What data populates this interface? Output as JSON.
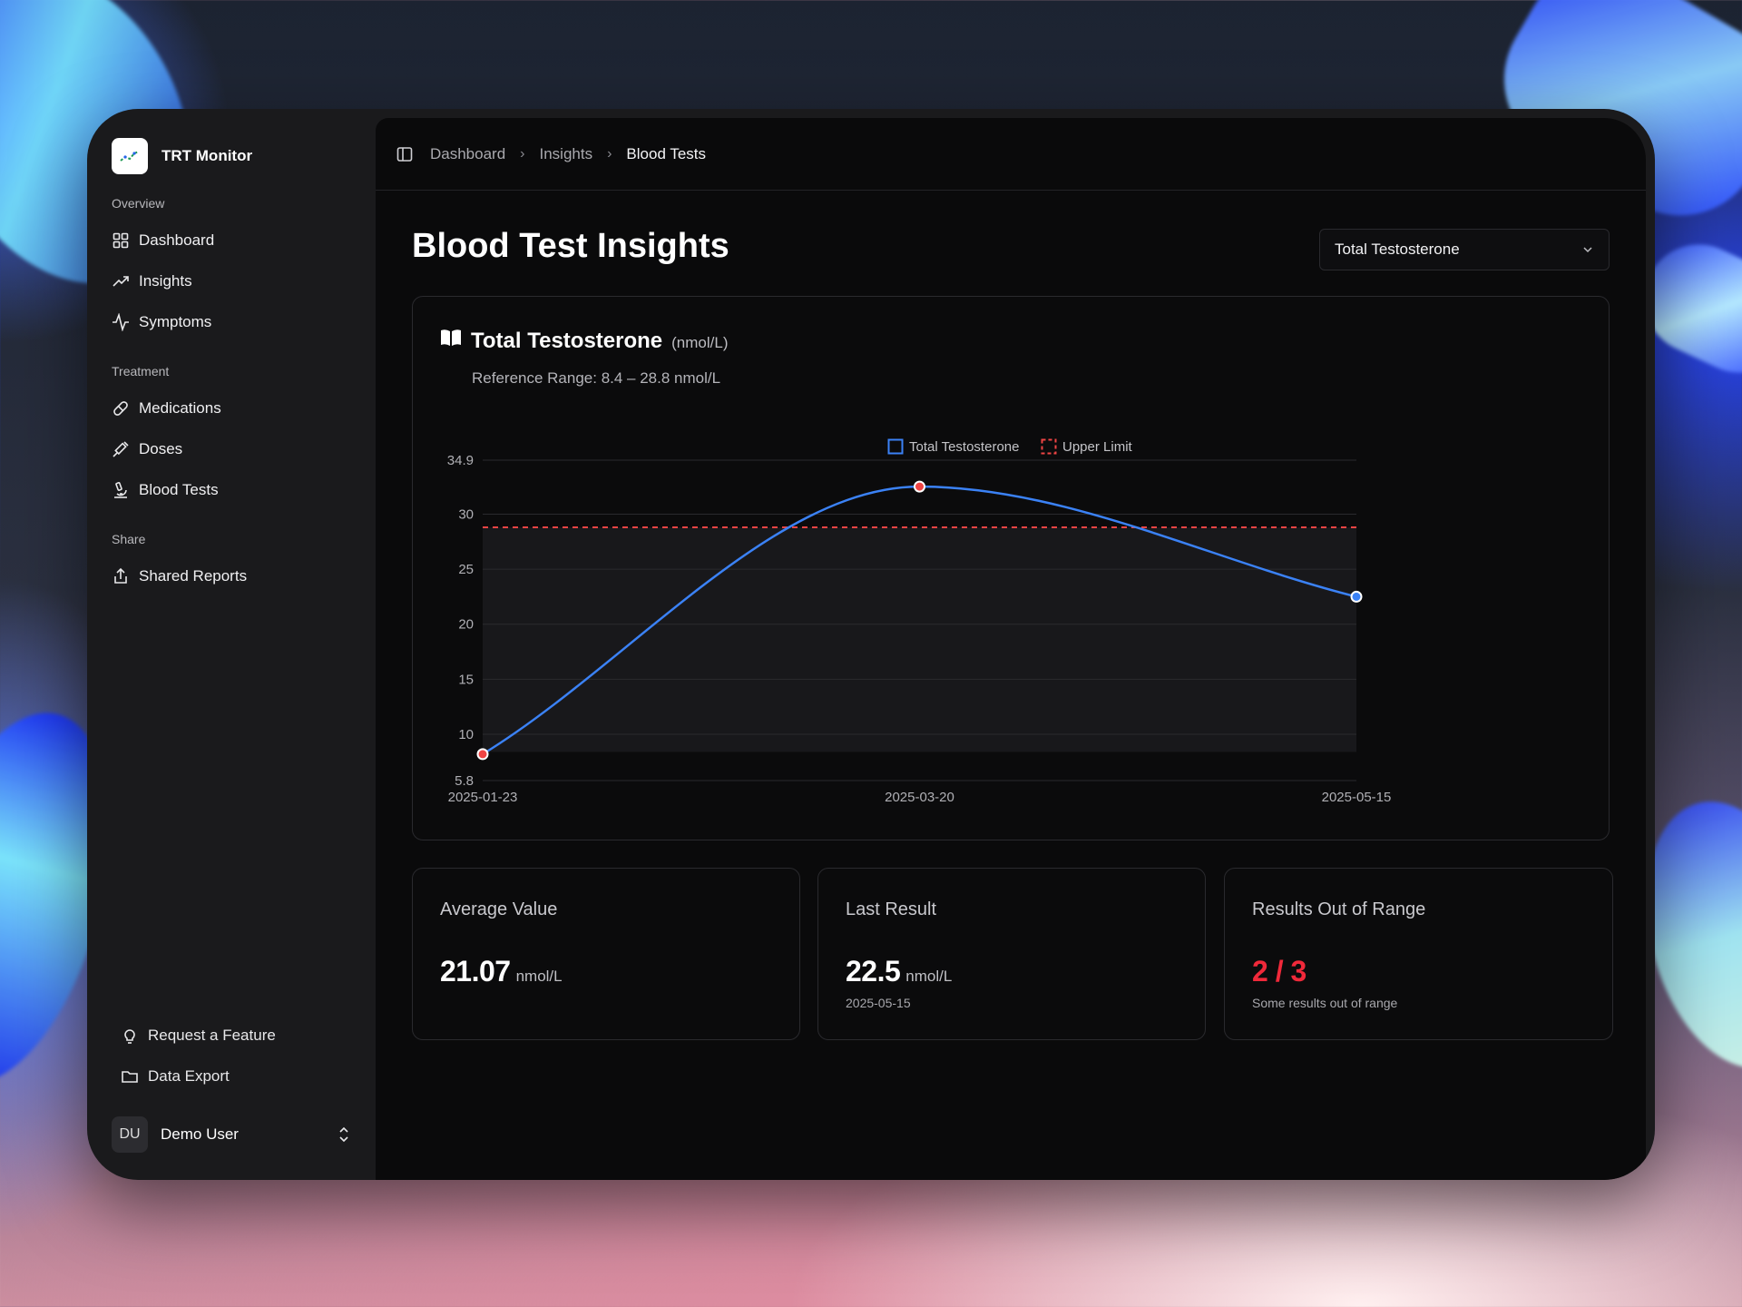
{
  "app": {
    "name": "TRT Monitor"
  },
  "sidebar": {
    "groups": [
      {
        "label": "Overview",
        "items": [
          {
            "label": "Dashboard",
            "icon": "grid-icon"
          },
          {
            "label": "Insights",
            "icon": "trending-up-icon"
          },
          {
            "label": "Symptoms",
            "icon": "activity-icon"
          }
        ]
      },
      {
        "label": "Treatment",
        "items": [
          {
            "label": "Medications",
            "icon": "pill-icon"
          },
          {
            "label": "Doses",
            "icon": "syringe-icon"
          },
          {
            "label": "Blood Tests",
            "icon": "microscope-icon"
          }
        ]
      },
      {
        "label": "Share",
        "items": [
          {
            "label": "Shared Reports",
            "icon": "share-icon"
          }
        ]
      }
    ],
    "bottom": [
      {
        "label": "Request a Feature",
        "icon": "lightbulb-icon"
      },
      {
        "label": "Data Export",
        "icon": "folder-icon"
      }
    ],
    "user": {
      "initials": "DU",
      "name": "Demo User"
    }
  },
  "breadcrumb": [
    "Dashboard",
    "Insights",
    "Blood Tests"
  ],
  "page": {
    "title": "Blood Test Insights",
    "select_value": "Total Testosterone"
  },
  "chart_card": {
    "title": "Total Testosterone",
    "unit": "(nmol/L)",
    "reference_range": "Reference Range: 8.4 – 28.8 nmol/L"
  },
  "chart_data": {
    "type": "line",
    "x": [
      "2025-01-23",
      "2025-03-20",
      "2025-05-15"
    ],
    "series": [
      {
        "name": "Total Testosterone",
        "values": [
          8.2,
          32.5,
          22.5
        ],
        "color": "#3b82f6"
      },
      {
        "name": "Upper Limit",
        "values": [
          28.8,
          28.8,
          28.8
        ],
        "color": "#ef4444",
        "style": "dashed"
      }
    ],
    "point_status": [
      "out",
      "out",
      "in"
    ],
    "reference_band": [
      8.4,
      28.8
    ],
    "ylim": [
      5.8,
      34.9
    ],
    "yticks": [
      "34.9",
      "30",
      "25",
      "20",
      "15",
      "10",
      "5.8"
    ],
    "legend": "top-center",
    "grid": true
  },
  "stats": {
    "average": {
      "label": "Average Value",
      "value": "21.07",
      "unit": "nmol/L"
    },
    "last": {
      "label": "Last Result",
      "value": "22.5",
      "unit": "nmol/L",
      "date": "2025-05-15"
    },
    "out_of_range": {
      "label": "Results Out of Range",
      "value": "2 / 3",
      "note": "Some results out of range"
    }
  },
  "colors": {
    "accent_blue": "#3b82f6",
    "alert_red": "#f0293a"
  }
}
